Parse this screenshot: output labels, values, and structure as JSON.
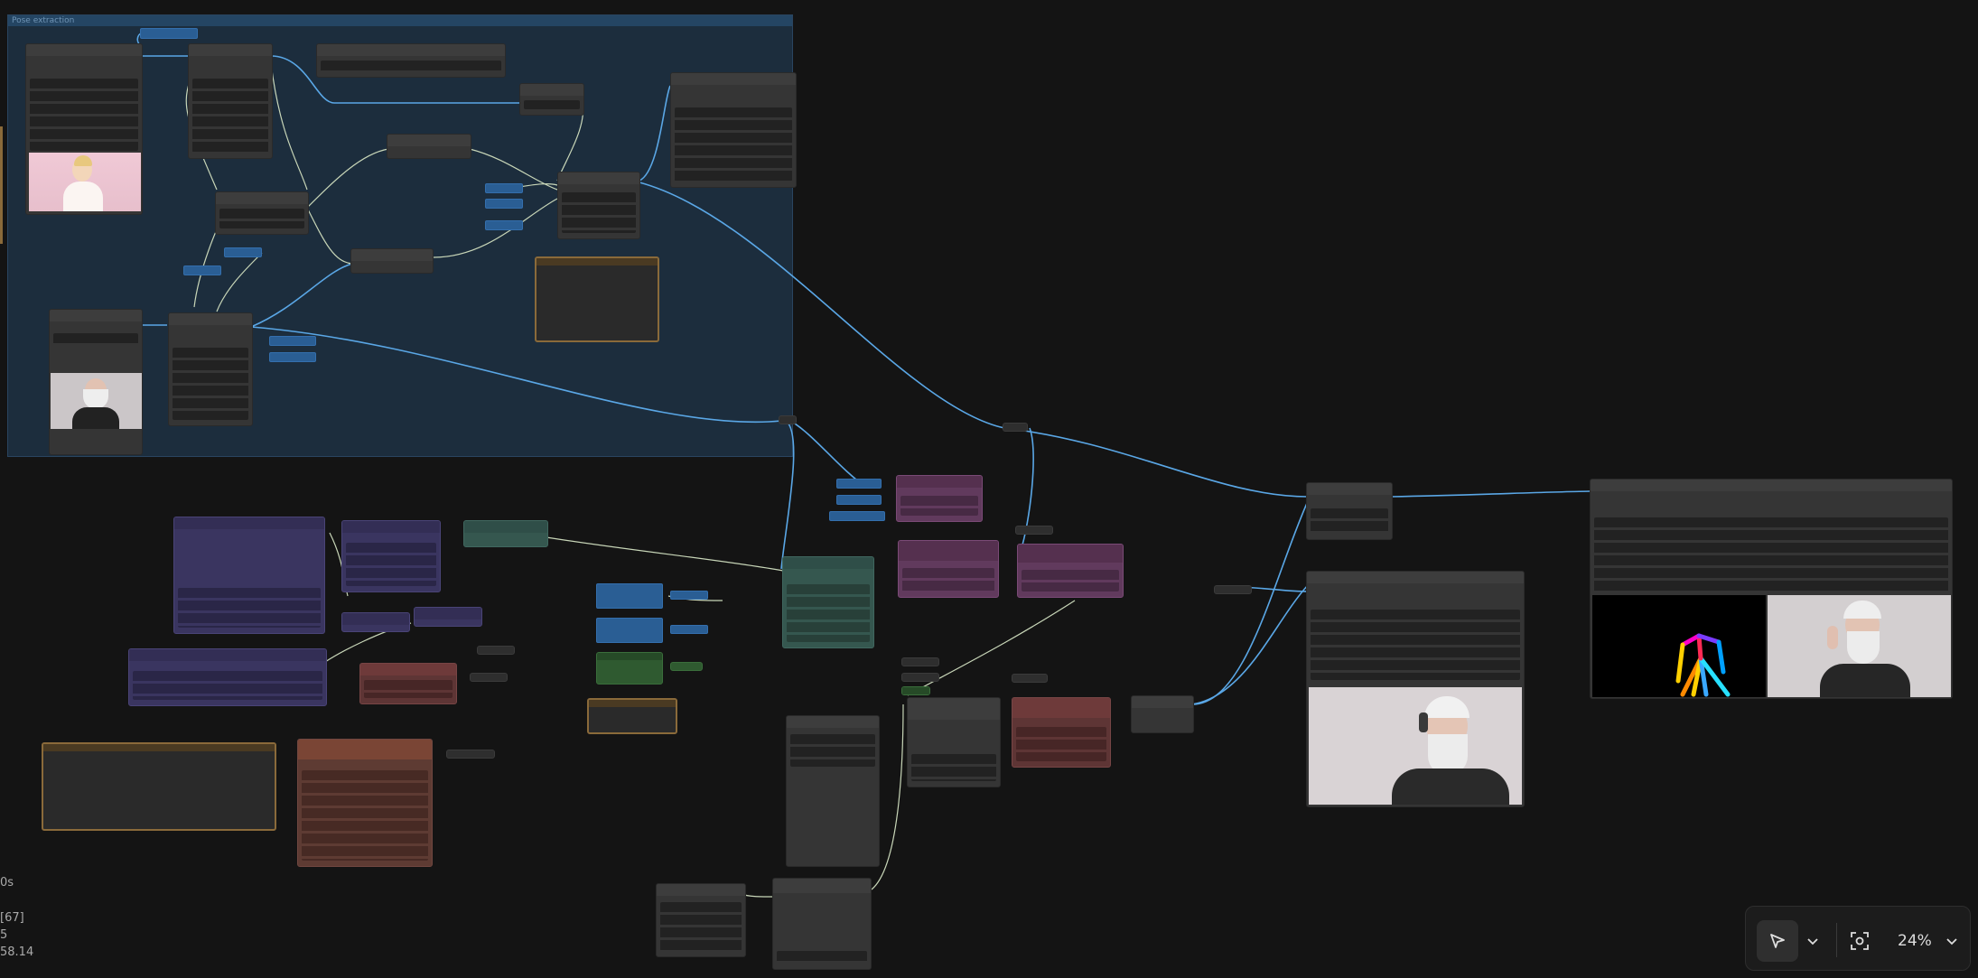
{
  "group": {
    "title": "Pose extraction"
  },
  "stats": {
    "line1": "0s",
    "line2": "[67]",
    "line3": "5",
    "line4": "58.14"
  },
  "toolbar": {
    "zoom": "24%"
  },
  "colors": {
    "link": "#5aa7e6",
    "link_light": "#c8d6b8",
    "canvas_bg": "#141414",
    "group_bg": "#1c2d3d"
  },
  "icons": {
    "select": "cursor-arrow-icon",
    "dropdown": "chevron-down-icon",
    "fit": "fit-view-icon"
  }
}
